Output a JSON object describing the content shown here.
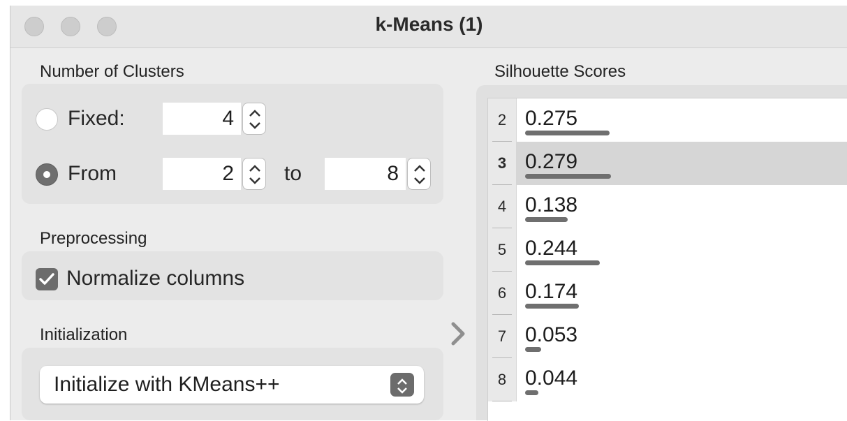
{
  "window": {
    "title": "k-Means (1)"
  },
  "clusters": {
    "heading": "Number of Clusters",
    "fixed": {
      "label": "Fixed:",
      "value": "4",
      "selected": false
    },
    "range": {
      "label": "From",
      "from_value": "2",
      "to_label": "to",
      "to_value": "8",
      "selected": true
    }
  },
  "preprocessing": {
    "heading": "Preprocessing",
    "normalize": {
      "label": "Normalize columns",
      "checked": true
    }
  },
  "initialization": {
    "heading": "Initialization",
    "method": "Initialize with KMeans++"
  },
  "silhouette": {
    "heading": "Silhouette Scores",
    "rows": [
      {
        "k": "2",
        "score": "0.275",
        "value": 0.275,
        "selected": false
      },
      {
        "k": "3",
        "score": "0.279",
        "value": 0.279,
        "selected": true
      },
      {
        "k": "4",
        "score": "0.138",
        "value": 0.138,
        "selected": false
      },
      {
        "k": "5",
        "score": "0.244",
        "value": 0.244,
        "selected": false
      },
      {
        "k": "6",
        "score": "0.174",
        "value": 0.174,
        "selected": false
      },
      {
        "k": "7",
        "score": "0.053",
        "value": 0.053,
        "selected": false
      },
      {
        "k": "8",
        "score": "0.044",
        "value": 0.044,
        "selected": false
      }
    ]
  },
  "colors": {
    "accent_gray": "#6f6f6f",
    "selected_row": "#d6d6d6"
  },
  "icons": [
    "close-icon",
    "minimize-icon",
    "zoom-icon",
    "stepper-icon",
    "checkmark-icon",
    "popup-arrows-icon",
    "chevron-right-icon"
  ]
}
